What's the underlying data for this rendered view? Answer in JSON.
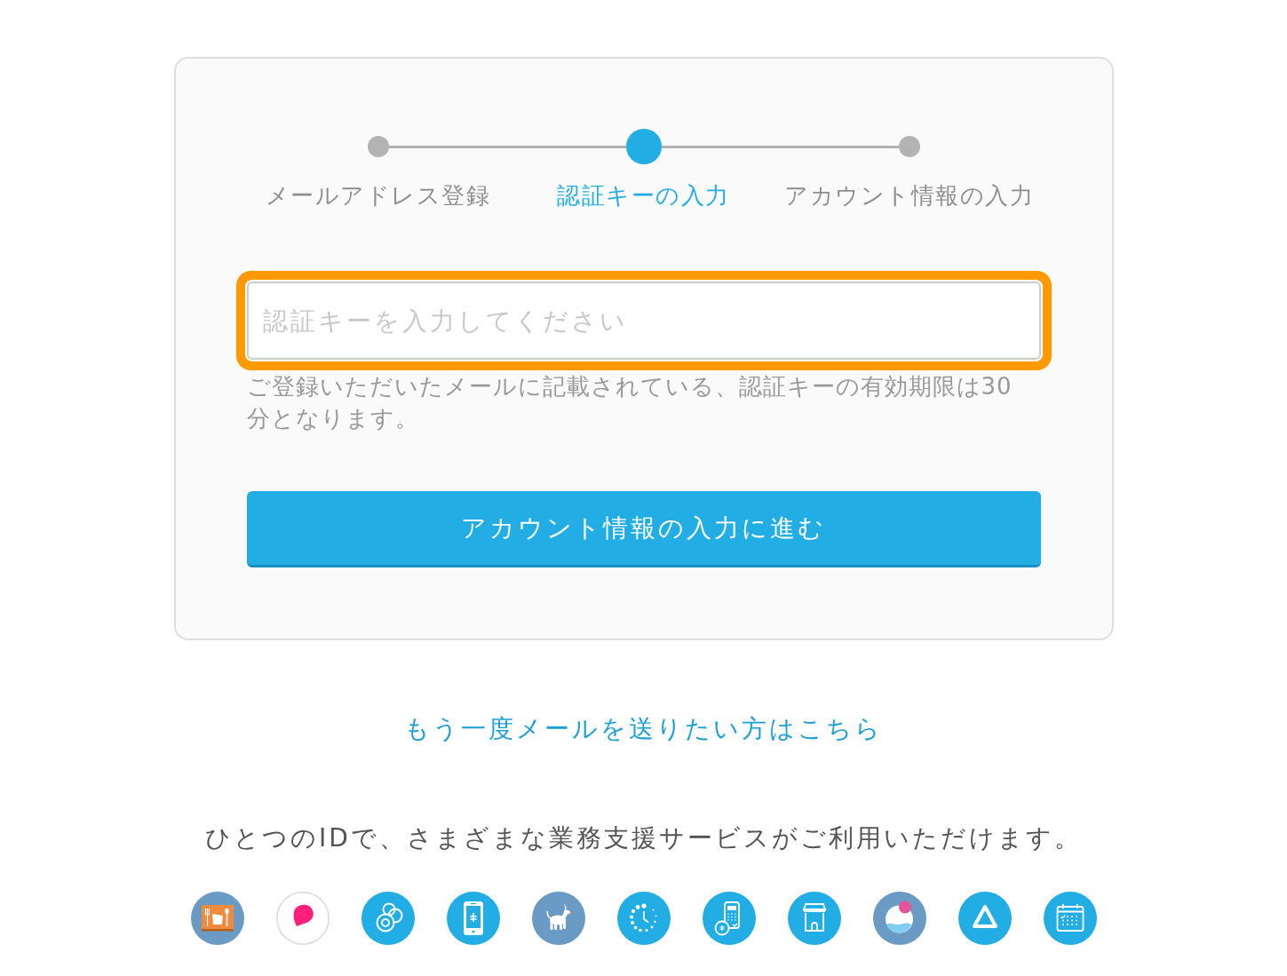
{
  "steps": [
    {
      "label": "メールアドレス登録",
      "current": false
    },
    {
      "label": "認証キーの入力",
      "current": true
    },
    {
      "label": "アカウント情報の入力",
      "current": false
    }
  ],
  "key_field": {
    "placeholder": "認証キーを入力してください",
    "focused": true
  },
  "help_text": "ご登録いただいたメールに記載されている、認証キーの有効期限は30分となります。",
  "submit_button": {
    "label": "アカウント情報の入力に進む"
  },
  "resend_link": "もう一度メールを送りたい方はこちら",
  "services_caption": "ひとつのIDで、さまざまな業務支援サービスがご利用いただけます。",
  "services": [
    {
      "kind": "restaurant"
    },
    {
      "kind": "chat"
    },
    {
      "kind": "points"
    },
    {
      "kind": "phone"
    },
    {
      "kind": "dog"
    },
    {
      "kind": "clock"
    },
    {
      "kind": "terminal"
    },
    {
      "kind": "store"
    },
    {
      "kind": "ring"
    },
    {
      "kind": "triangle"
    },
    {
      "kind": "calendar"
    }
  ]
}
